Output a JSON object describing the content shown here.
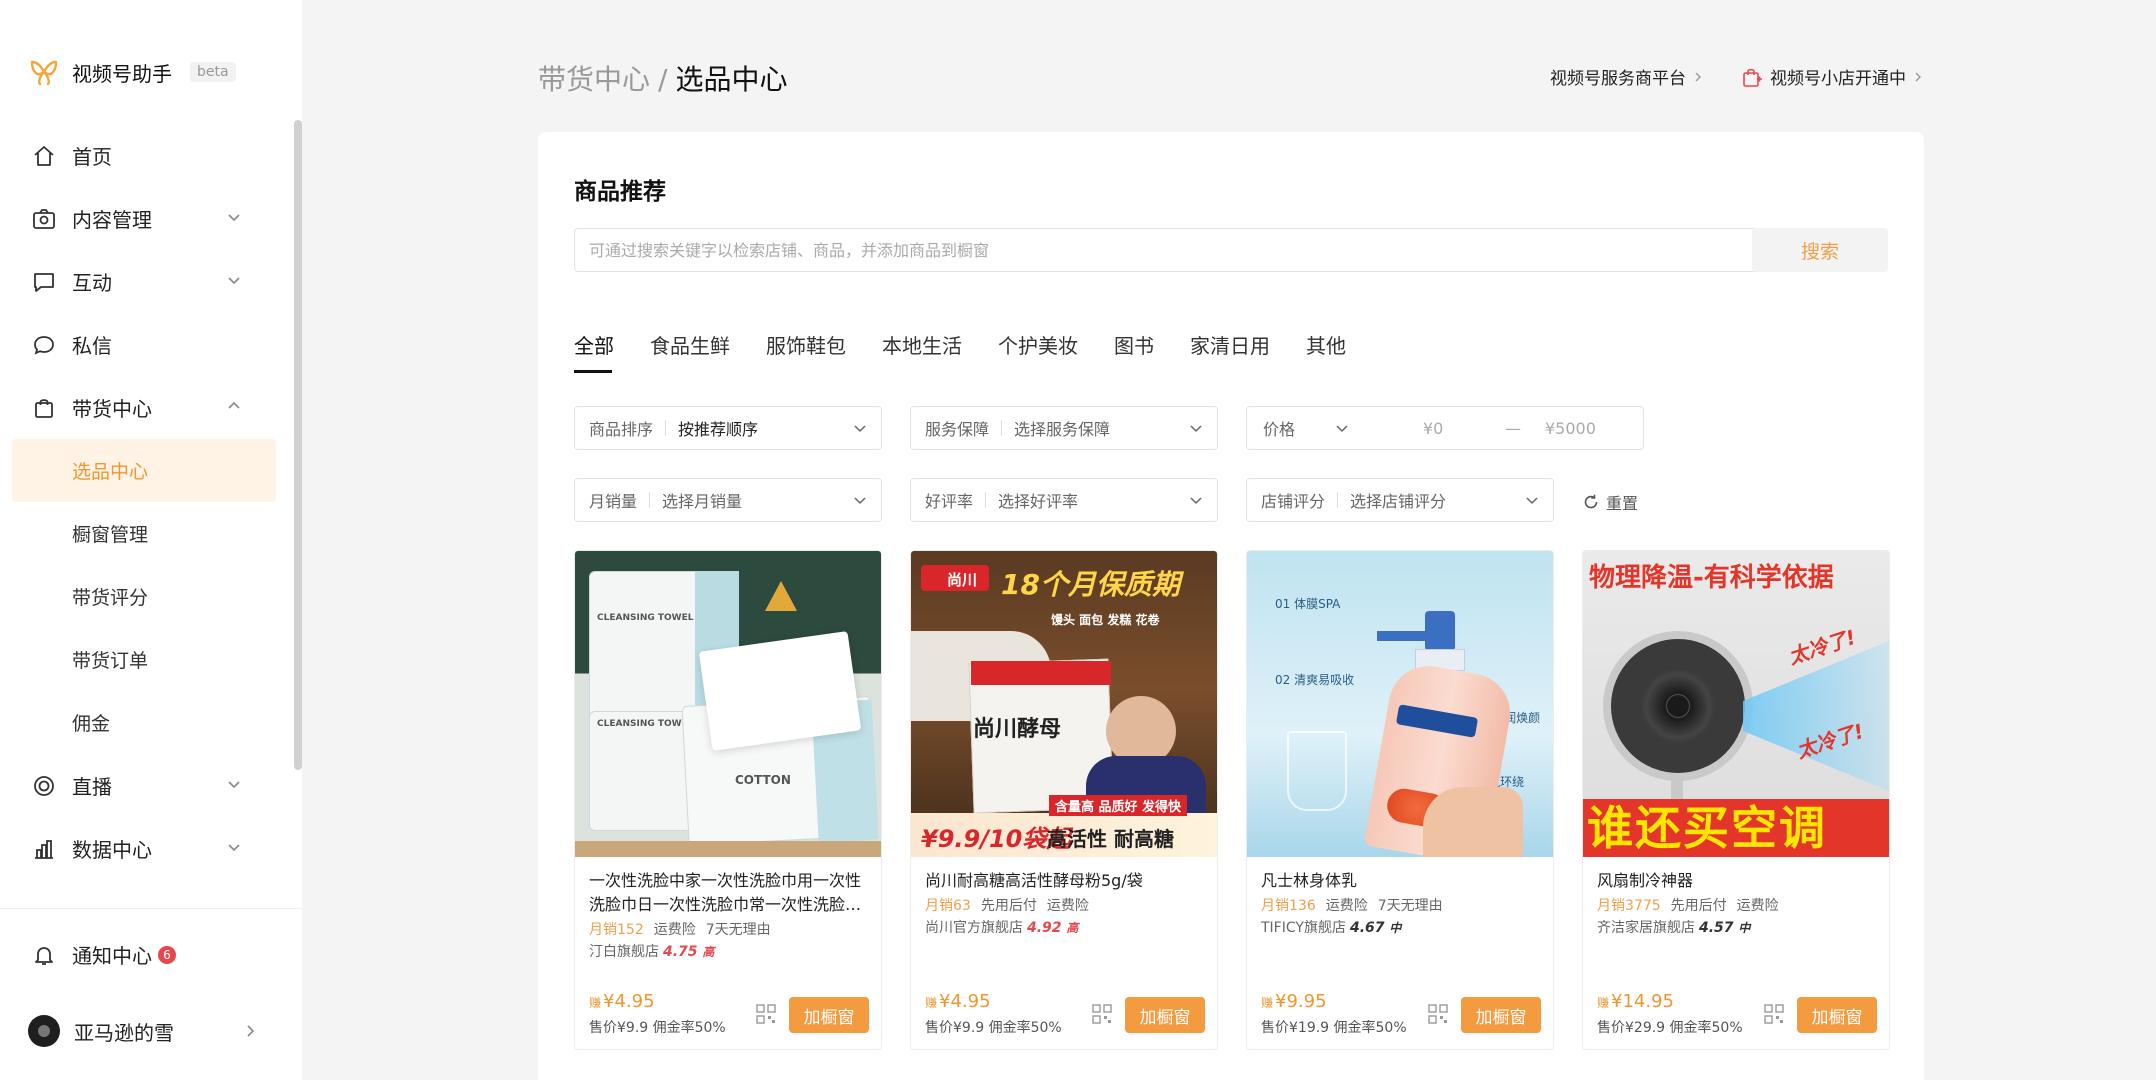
{
  "app": {
    "name": "视频号助手",
    "beta": "beta"
  },
  "sidebar": {
    "items": [
      {
        "label": "首页",
        "icon": "home-icon"
      },
      {
        "label": "内容管理",
        "icon": "camera-icon"
      },
      {
        "label": "互动",
        "icon": "comment-icon"
      },
      {
        "label": "私信",
        "icon": "chat-bubble-icon"
      },
      {
        "label": "带货中心",
        "icon": "shopping-bag-icon"
      }
    ],
    "sub_items": [
      "选品中心",
      "橱窗管理",
      "带货评分",
      "带货订单",
      "佣金"
    ],
    "items_bottom": [
      {
        "label": "直播",
        "icon": "live-icon"
      },
      {
        "label": "数据中心",
        "icon": "bar-chart-icon"
      }
    ],
    "notify": {
      "label": "通知中心",
      "count": "6"
    },
    "user": {
      "name": "亚马逊的雪"
    }
  },
  "header": {
    "breadcrumb_parent": "带货中心",
    "breadcrumb_sep": "/",
    "breadcrumb_current": "选品中心",
    "link_1": "视频号服务商平台",
    "link_2": "视频号小店开通中"
  },
  "main": {
    "title": "商品推荐",
    "search_placeholder": "可通过搜索关键字以检索店铺、商品，并添加商品到橱窗",
    "search_button": "搜索",
    "tabs": [
      "全部",
      "食品生鲜",
      "服饰鞋包",
      "本地生活",
      "个护美妆",
      "图书",
      "家清日用",
      "其他"
    ],
    "filters": {
      "sort": {
        "label": "商品排序",
        "value": "按推荐顺序"
      },
      "service": {
        "label": "服务保障",
        "value": "选择服务保障"
      },
      "price": {
        "label": "价格",
        "min": "¥0",
        "dash": "—",
        "max": "¥5000"
      },
      "sales": {
        "label": "月销量",
        "value": "选择月销量"
      },
      "rating": {
        "label": "好评率",
        "value": "选择好评率"
      },
      "shop_score": {
        "label": "店铺评分",
        "value": "选择店铺评分"
      },
      "reset": "重置"
    }
  },
  "products": [
    {
      "name": "一次性洗脸中家一次性洗脸巾用一次性洗脸巾日一次性洗脸巾常一次性洗脸…",
      "sales": "月销152",
      "tags": [
        "运费险",
        "7天无理由"
      ],
      "shop": "汀白旗舰店",
      "score": "4.75",
      "level": "高",
      "earn": "¥4.95",
      "earn_prefix": "赚",
      "price_info": "售价¥9.9 佣金率50%",
      "image_texts": [
        "CLEANSING TOWEL",
        "CLEANSING TOWEL",
        "COTTON"
      ]
    },
    {
      "name": "尚川耐高糖高活性酵母粉5g/袋",
      "sales": "月销63",
      "tags": [
        "先用后付",
        "运费险"
      ],
      "shop": "尚川官方旗舰店",
      "score": "4.92",
      "level": "高",
      "earn": "¥4.95",
      "earn_prefix": "赚",
      "price_info": "售价¥9.9 佣金率50%",
      "image_texts": [
        "尚川",
        "18个月保质期",
        "馒头 面包 发糕 花卷",
        "尚川酵母",
        "含量高 品质好 发得快",
        "¥9.9/10袋起",
        "高活性 耐高糖"
      ]
    },
    {
      "name": "凡士林身体乳",
      "sales": "月销136",
      "tags": [
        "运费险",
        "7天无理由"
      ],
      "shop": "TIFICY旗舰店",
      "score": "4.67",
      "level": "中",
      "earn": "¥9.95",
      "earn_prefix": "赚",
      "price_info": "售价¥19.9 佣金率50%",
      "image_texts": [
        "01 体膜SPA",
        "02 清爽易吸收",
        "03 莹润焕颜",
        "04 香氛环绕"
      ]
    },
    {
      "name": "风扇制冷神器",
      "sales": "月销3775",
      "tags": [
        "先用后付",
        "运费险"
      ],
      "shop": "齐洁家居旗舰店",
      "score": "4.57",
      "level": "中",
      "earn": "¥14.95",
      "earn_prefix": "赚",
      "price_info": "售价¥29.9 佣金率50%",
      "image_texts": [
        "物理降温-有科学依据",
        "太冷了!",
        "太冷了!",
        "谁还买空调"
      ]
    }
  ],
  "add_button_label": "加橱窗",
  "colors": {
    "accent": "#f59b3f",
    "active_bg": "#fff3e6",
    "badge": "#e5484d"
  }
}
